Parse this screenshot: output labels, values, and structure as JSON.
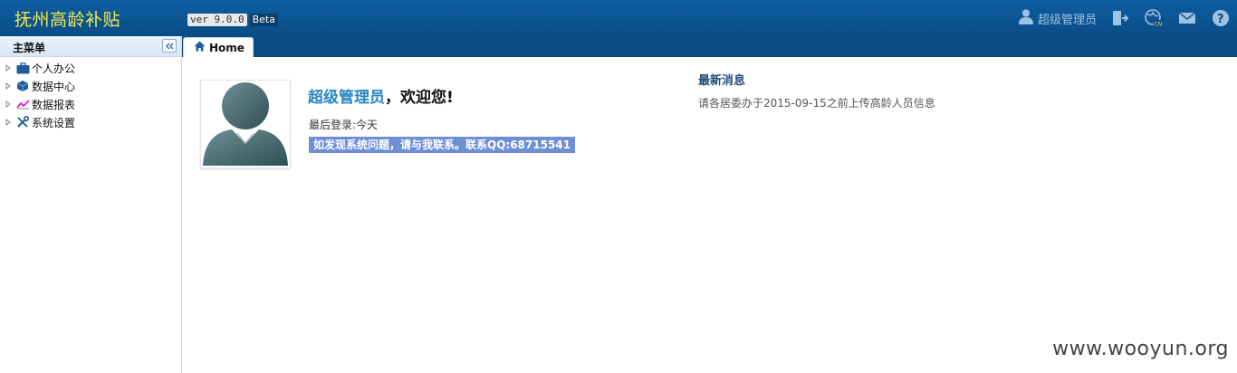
{
  "app": {
    "title": "抚州高龄补贴",
    "version": "ver 9.0.0",
    "beta": "Beta"
  },
  "topbar": {
    "user": "超级管理员",
    "icons": [
      "logout-icon",
      "language-icon",
      "mail-icon",
      "help-icon"
    ]
  },
  "sidebar": {
    "title": "主菜单",
    "items": [
      {
        "label": "个人办公",
        "icon": "briefcase-icon"
      },
      {
        "label": "数据中心",
        "icon": "cube-icon"
      },
      {
        "label": "数据报表",
        "icon": "chart-icon"
      },
      {
        "label": "系统设置",
        "icon": "tools-icon"
      }
    ]
  },
  "tabs": [
    {
      "label": "Home",
      "icon": "home-icon"
    }
  ],
  "main": {
    "username": "超级管理员",
    "welcome_suffix": "，欢迎您!",
    "last_login": "最后登录:今天",
    "notice": "如发现系统问题，请与我联系。联系QQ:68715541",
    "news_title": "最新消息",
    "news_item": "请各居委办于2015-09-15之前上传高龄人员信息"
  },
  "watermark": "www.wooyun.org",
  "colors": {
    "topbar": "#0a4d86",
    "app_title": "#f5e94a",
    "username": "#2a87c2",
    "notice_bg": "#6e8fd6"
  }
}
